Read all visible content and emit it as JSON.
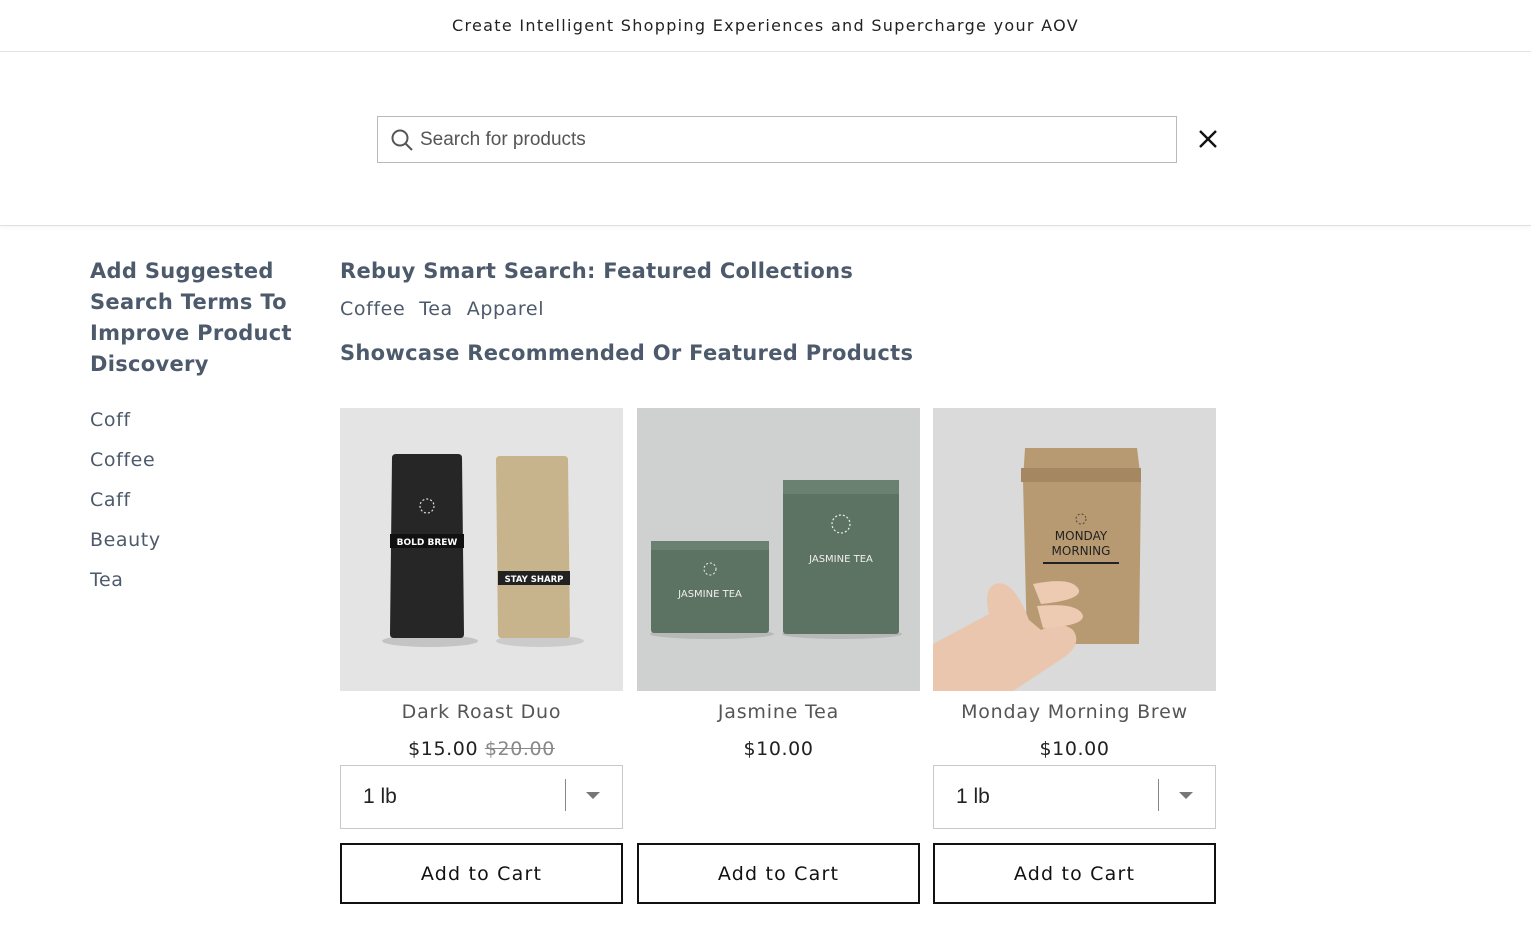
{
  "announcement": {
    "text": "Create Intelligent Shopping Experiences and Supercharge your AOV"
  },
  "search": {
    "placeholder": "Search for products",
    "value": ""
  },
  "sidebar": {
    "title": "Add Suggested Search Terms To Improve Product Discovery",
    "suggestions": [
      "Coff",
      "Coffee",
      "Caff",
      "Beauty",
      "Tea"
    ]
  },
  "main": {
    "collections_title": "Rebuy Smart Search: Featured Collections",
    "collections": [
      "Coffee",
      "Tea",
      "Apparel"
    ],
    "products_title": "Showcase Recommended Or Featured Products"
  },
  "products": [
    {
      "name": "Dark Roast Duo",
      "price": "$15.00",
      "compare_price": "$20.00",
      "variant": "1 lb",
      "add_label": "Add to Cart",
      "image": {
        "bag1_label": "BOLD BREW",
        "bag2_label": "STAY SHARP"
      }
    },
    {
      "name": "Jasmine Tea",
      "price": "$10.00",
      "add_label": "Add to Cart",
      "image": {
        "tin_label": "JASMINE TEA"
      }
    },
    {
      "name": "Monday Morning Brew",
      "price": "$10.00",
      "variant": "1 lb",
      "add_label": "Add to Cart",
      "image": {
        "bag_label_line1": "MONDAY",
        "bag_label_line2": "MORNING"
      }
    }
  ],
  "colors": {
    "heading": "#4d5a6b",
    "tea_tin": "#5c7263",
    "coffee_bag_dark": "#262626",
    "coffee_bag_kraft": "#c7b38c"
  }
}
